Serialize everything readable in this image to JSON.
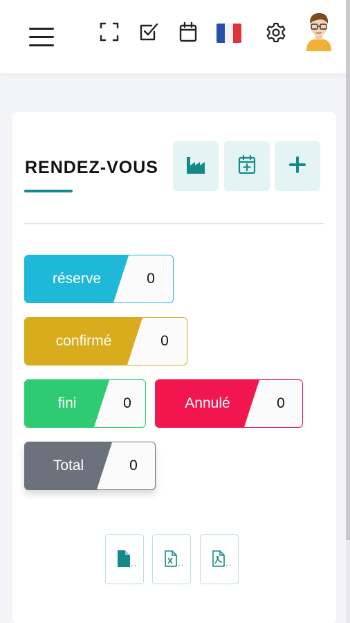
{
  "colors": {
    "accent": "#138a8a",
    "reserve": "#1fb8d8",
    "confirme": "#d9ac1e",
    "fini": "#2ecb72",
    "annule": "#f2164f",
    "total": "#6b727b"
  },
  "header": {
    "icons": [
      "menu-icon",
      "fullscreen-icon",
      "checkbox-icon",
      "calendar-icon",
      "french-flag-icon",
      "gear-icon",
      "avatar"
    ]
  },
  "page": {
    "title": "RENDEZ-VOUS",
    "actions": [
      "factory-icon",
      "calendar-add-icon",
      "plus-icon"
    ]
  },
  "statuses": {
    "reserve": {
      "label": "réserve",
      "value": "0"
    },
    "confirme": {
      "label": "confirmé",
      "value": "0"
    },
    "fini": {
      "label": "fini",
      "value": "0"
    },
    "annule": {
      "label": "Annulé",
      "value": "0"
    },
    "total": {
      "label": "Total",
      "value": "0"
    }
  },
  "exports": {
    "dots": "..",
    "icons": [
      "file-icon",
      "excel-file-icon",
      "pdf-file-icon"
    ]
  }
}
